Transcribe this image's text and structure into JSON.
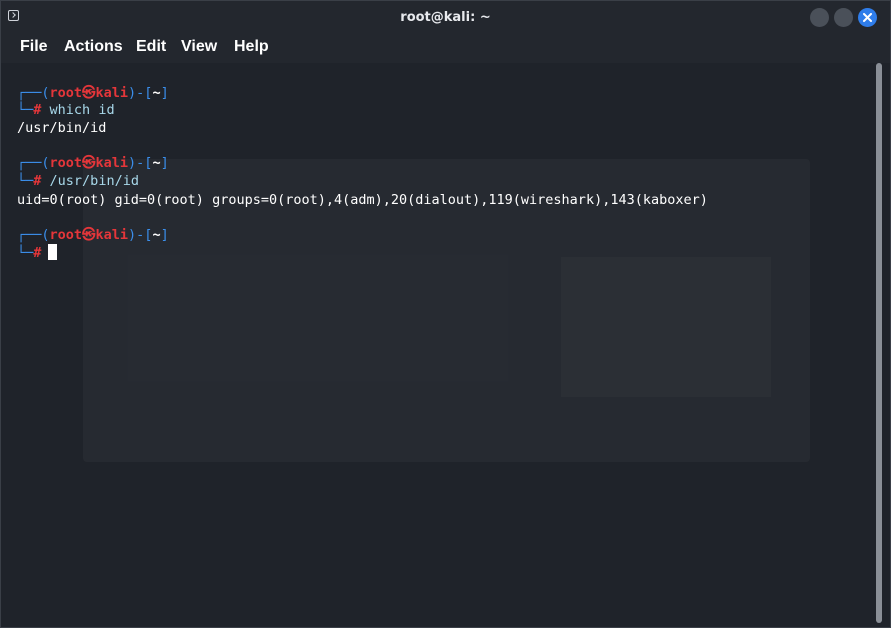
{
  "window": {
    "title": "root@kali: ~"
  },
  "menu": [
    "File",
    "Actions",
    "Edit",
    "View",
    "Help"
  ],
  "colors": {
    "prompt_frame": "#3b8eea",
    "prompt_user": "#e4363a",
    "background": "#1f232a",
    "close_button": "#2f7dea"
  },
  "terminal": {
    "prompts": [
      {
        "bracket_open": "┌──(",
        "user": "root",
        "skull": "㉿",
        "host": "kali",
        "bracket_mid": ")-[",
        "dir": "~",
        "bracket_close": "]",
        "hash_prefix": "└─",
        "hash": "#",
        "command": "which id"
      },
      {
        "bracket_open": "┌──(",
        "user": "root",
        "skull": "㉿",
        "host": "kali",
        "bracket_mid": ")-[",
        "dir": "~",
        "bracket_close": "]",
        "hash_prefix": "└─",
        "hash": "#",
        "command": "/usr/bin/id"
      },
      {
        "bracket_open": "┌──(",
        "user": "root",
        "skull": "㉿",
        "host": "kali",
        "bracket_mid": ")-[",
        "dir": "~",
        "bracket_close": "]",
        "hash_prefix": "└─",
        "hash": "#",
        "command": ""
      }
    ],
    "outputs": [
      "/usr/bin/id",
      "uid=0(root) gid=0(root) groups=0(root),4(adm),20(dialout),119(wireshark),143(kaboxer)"
    ]
  },
  "icons": {
    "app": "terminal-icon",
    "minimize": "minimize-icon",
    "maximize": "maximize-icon",
    "close": "close-icon"
  }
}
